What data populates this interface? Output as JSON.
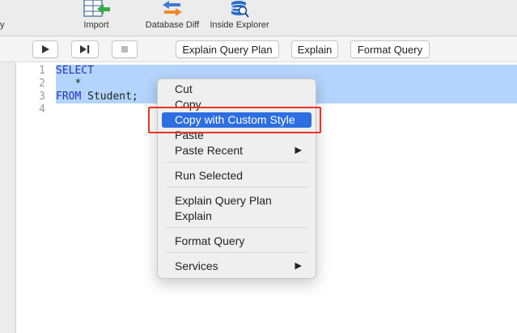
{
  "toolbar": {
    "cut_label": "y",
    "import_label": "Import",
    "database_diff_label": "Database Diff",
    "inside_explorer_label": "Inside Explorer"
  },
  "query_toolbar": {
    "explain_query_plan": "Explain Query Plan",
    "explain": "Explain",
    "format_query": "Format Query"
  },
  "editor": {
    "lines": [
      {
        "num": "1",
        "text": "SELECT"
      },
      {
        "num": "2",
        "text": "   *"
      },
      {
        "num": "3",
        "text": "FROM Student;"
      },
      {
        "num": "4",
        "text": ""
      }
    ],
    "kw_from": "FROM",
    "rest_line3": " Student;"
  },
  "context_menu": {
    "cut": "Cut",
    "copy": "Copy",
    "copy_custom": "Copy with Custom Style",
    "paste": "Paste",
    "paste_recent": "Paste Recent",
    "run_selected": "Run Selected",
    "explain_query_plan": "Explain Query Plan",
    "explain": "Explain",
    "format_query": "Format Query",
    "services": "Services",
    "submenu_arrow": "▶"
  },
  "colors": {
    "selection": "#b3d4fc",
    "highlight": "#2d6ee0",
    "annotation": "#e8351f",
    "keyword": "#1f33b8"
  }
}
